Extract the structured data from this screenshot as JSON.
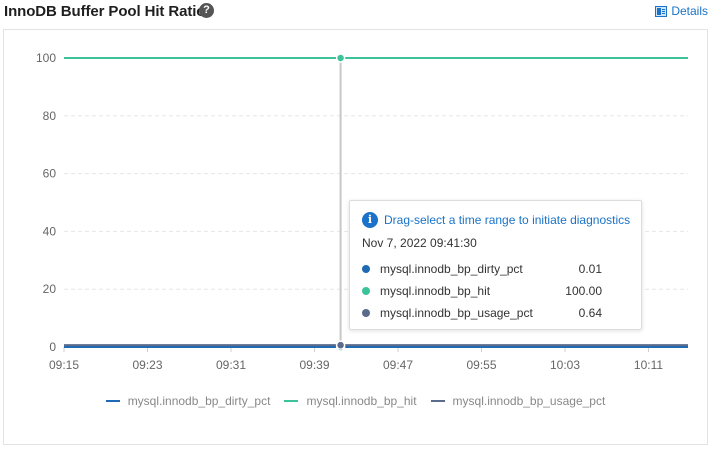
{
  "header": {
    "title": "InnoDB Buffer Pool Hit Ratio",
    "help_icon": "question-circle-icon",
    "details_label": "Details",
    "details_icon": "table-icon"
  },
  "colors": {
    "dirty": "#1f6ab5",
    "hit": "#3cc39a",
    "usage": "#5a6b8c",
    "grid": "#e6e6e6",
    "crosshair": "#c8c8c8",
    "accent": "#1a73c8"
  },
  "chart_data": {
    "type": "line",
    "x": [
      "09:15",
      "09:23",
      "09:31",
      "09:39",
      "09:47",
      "09:55",
      "10:03",
      "10:11"
    ],
    "yticks": [
      "0",
      "20",
      "40",
      "60",
      "80",
      "100"
    ],
    "ylim": [
      0,
      100
    ],
    "grid": true,
    "legend_position": "bottom-center",
    "series": [
      {
        "name": "mysql.innodb_bp_dirty_pct",
        "color": "#1f6ab5",
        "values": [
          0.01,
          0.01,
          0.01,
          0.01,
          0.01,
          0.01,
          0.01,
          0.01,
          0.01
        ]
      },
      {
        "name": "mysql.innodb_bp_hit",
        "color": "#3cc39a",
        "values": [
          100,
          100,
          100,
          100,
          100,
          100,
          100,
          100,
          100
        ]
      },
      {
        "name": "mysql.innodb_bp_usage_pct",
        "color": "#5a6b8c",
        "values": [
          0.64,
          0.64,
          0.64,
          0.64,
          0.64,
          0.64,
          0.64,
          0.64,
          0.64
        ]
      }
    ]
  },
  "tooltip": {
    "hint": "Drag-select a time range to initiate diagnostics",
    "hint_icon": "info-icon",
    "time": "Nov 7, 2022 09:41:30",
    "rows": [
      {
        "name": "mysql.innodb_bp_dirty_pct",
        "value": "0.01",
        "color": "#1f6ab5"
      },
      {
        "name": "mysql.innodb_bp_hit",
        "value": "100.00",
        "color": "#3cc39a"
      },
      {
        "name": "mysql.innodb_bp_usage_pct",
        "value": "0.64",
        "color": "#5a6b8c"
      }
    ]
  }
}
